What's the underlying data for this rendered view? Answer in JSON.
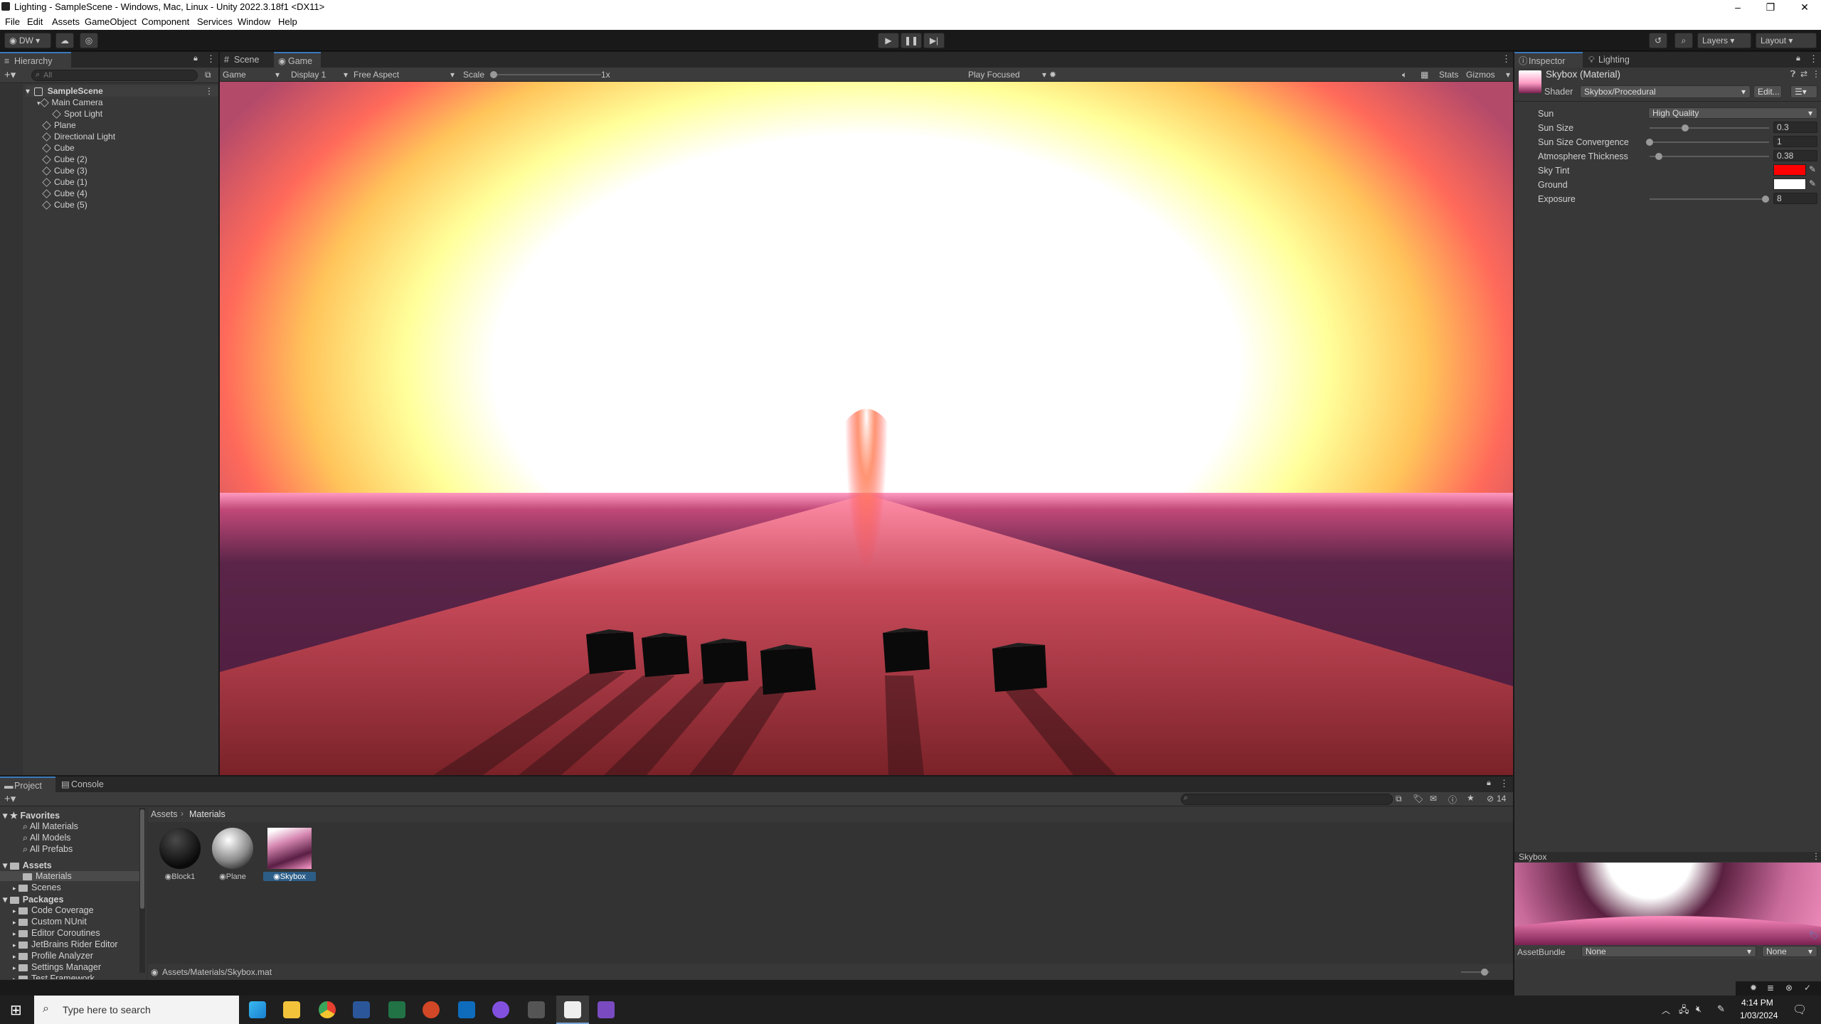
{
  "window": {
    "title": "Lighting - SampleScene - Windows, Mac, Linux - Unity 2022.3.18f1 <DX11>"
  },
  "menu": [
    "File",
    "Edit",
    "Assets",
    "GameObject",
    "Component",
    "Services",
    "Window",
    "Help"
  ],
  "toolbar": {
    "account": "DW",
    "layers": "Layers",
    "layout": "Layout"
  },
  "hierarchy": {
    "tab": "Hierarchy",
    "search_placeholder": "All",
    "scene": "SampleScene",
    "items": [
      "Main Camera",
      "Spot Light",
      "Plane",
      "Directional Light",
      "Cube",
      "Cube (2)",
      "Cube (3)",
      "Cube (1)",
      "Cube (4)",
      "Cube (5)"
    ]
  },
  "game": {
    "tabs": [
      "Scene",
      "Game"
    ],
    "display_mode": "Game",
    "display": "Display 1",
    "aspect": "Free Aspect",
    "scale_label": "Scale",
    "scale_value": "1x",
    "play_mode": "Play Focused",
    "stats": "Stats",
    "gizmos": "Gizmos"
  },
  "inspector": {
    "tabs": [
      "Inspector",
      "Lighting"
    ],
    "material_name": "Skybox (Material)",
    "shader_label": "Shader",
    "shader": "Skybox/Procedural",
    "edit": "Edit...",
    "props": [
      {
        "label": "Sun",
        "value": "High Quality",
        "kind": "dropdown"
      },
      {
        "label": "Sun Size",
        "value": "0.3",
        "kind": "slider",
        "fraction": 0.3
      },
      {
        "label": "Sun Size Convergence",
        "value": "1",
        "kind": "slider",
        "fraction": 0.0
      },
      {
        "label": "Atmosphere Thickness",
        "value": "0.38",
        "kind": "slider",
        "fraction": 0.08
      },
      {
        "label": "Sky Tint",
        "kind": "color",
        "color": "#ff0000"
      },
      {
        "label": "Ground",
        "kind": "color",
        "color": "#ffffff"
      },
      {
        "label": "Exposure",
        "value": "8",
        "kind": "slider",
        "fraction": 0.97
      }
    ],
    "preview_label": "Skybox",
    "assetbundle_label": "AssetBundle",
    "assetbundle_value": "None",
    "assetbundle_variant": "None"
  },
  "project": {
    "tabs": [
      "Project",
      "Console"
    ],
    "favorites_label": "Favorites",
    "favorites": [
      "All Materials",
      "All Models",
      "All Prefabs"
    ],
    "assets_label": "Assets",
    "assets_children": [
      "Materials",
      "Scenes"
    ],
    "packages_label": "Packages",
    "packages": [
      "Code Coverage",
      "Custom NUnit",
      "Editor Coroutines",
      "JetBrains Rider Editor",
      "Profile Analyzer",
      "Settings Manager",
      "Test Framework"
    ],
    "breadcrumb": [
      "Assets",
      "Materials"
    ],
    "files": [
      "Block1",
      "Plane",
      "Skybox"
    ],
    "path": "Assets/Materials/Skybox.mat",
    "count": "14"
  },
  "taskbar": {
    "search_placeholder": "Type here to search",
    "time": "4:14 PM",
    "date": "1/03/2024"
  },
  "colors": {
    "accent": "#3a79bb",
    "panel": "#383838",
    "dark": "#191919"
  }
}
